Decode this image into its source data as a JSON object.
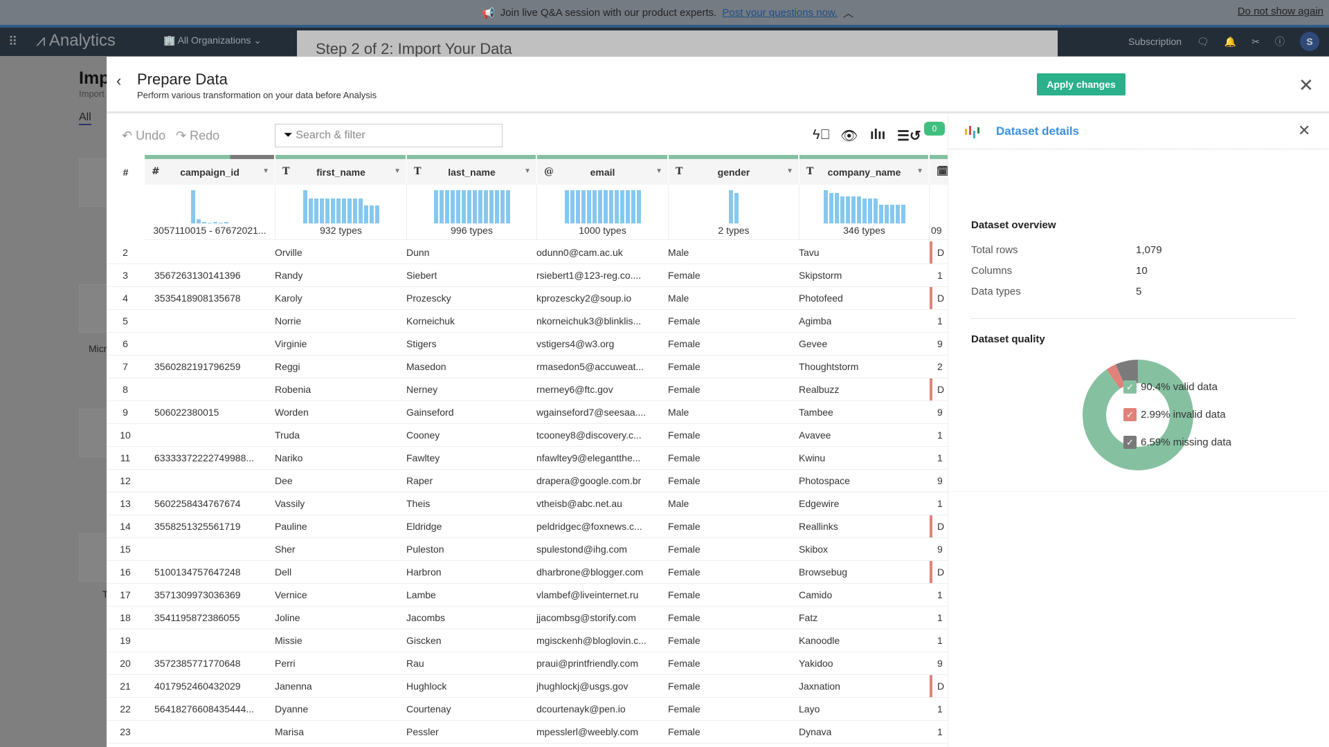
{
  "banner": {
    "message": "Join live Q&A session with our product experts.",
    "link": "Post your questions now.",
    "dismiss": "Do not show again"
  },
  "nav": {
    "app": "Analytics",
    "org": "All Organizations",
    "subscription": "Subscription",
    "avatar": "S"
  },
  "background": {
    "step": "Step 2 of 2: Import Your Data",
    "title": "Imp",
    "subtitle": "Import",
    "tab": "All",
    "card_text": "Micr",
    "card_text2": "T"
  },
  "modal": {
    "title": "Prepare Data",
    "subtitle": "Perform various transformation on your data before Analysis",
    "apply": "Apply changes"
  },
  "toolbar": {
    "undo": "Undo",
    "redo": "Redo",
    "search_placeholder": "Search & filter",
    "badge": "0"
  },
  "table": {
    "index_header": "#",
    "columns": [
      {
        "name": "campaign_id",
        "type": "#",
        "summary": "3057110015 - 67672021...",
        "hist": [
          100,
          12,
          4,
          3,
          4,
          3,
          4
        ],
        "quality": [
          0.66,
          0.34
        ]
      },
      {
        "name": "first_name",
        "type": "T",
        "summary": "932 types",
        "hist": [
          100,
          75,
          75,
          75,
          75,
          75,
          75,
          75,
          75,
          75,
          75,
          55,
          55,
          55
        ],
        "quality": [
          1,
          0
        ]
      },
      {
        "name": "last_name",
        "type": "T",
        "summary": "996 types",
        "hist": [
          100,
          100,
          100,
          100,
          100,
          100,
          100,
          100,
          100,
          100,
          100,
          100,
          100,
          100
        ],
        "quality": [
          1,
          0
        ]
      },
      {
        "name": "email",
        "type": "@",
        "summary": "1000 types",
        "hist": [
          100,
          100,
          100,
          100,
          100,
          100,
          100,
          100,
          100,
          100,
          100,
          100,
          100,
          100
        ],
        "quality": [
          1,
          0
        ]
      },
      {
        "name": "gender",
        "type": "T",
        "summary": "2 types",
        "hist": [
          100,
          92
        ],
        "quality": [
          1,
          0
        ]
      },
      {
        "name": "company_name",
        "type": "T",
        "summary": "346 types",
        "hist": [
          100,
          92,
          92,
          82,
          82,
          82,
          82,
          74,
          74,
          74,
          57,
          57,
          57,
          57,
          57
        ],
        "quality": [
          1,
          0
        ]
      },
      {
        "name": "",
        "type": "date",
        "summary": "09",
        "hist": [],
        "quality": [
          1,
          0
        ]
      }
    ],
    "rows": [
      [
        "2",
        "",
        "Orville",
        "Dunn",
        "odunn0@cam.ac.uk",
        "Male",
        "Tavu",
        "D",
        true
      ],
      [
        "3",
        "3567263130141396",
        "Randy",
        "Siebert",
        "rsiebert1@123-reg.co....",
        "Female",
        "Skipstorm",
        "1",
        false
      ],
      [
        "4",
        "3535418908135678",
        "Karoly",
        "Prozescky",
        "kprozescky2@soup.io",
        "Male",
        "Photofeed",
        "D",
        true
      ],
      [
        "5",
        "",
        "Norrie",
        "Korneichuk",
        "nkorneichuk3@blinklis...",
        "Female",
        "Agimba",
        "1",
        false
      ],
      [
        "6",
        "",
        "Virginie",
        "Stigers",
        "vstigers4@w3.org",
        "Female",
        "Gevee",
        "9",
        false
      ],
      [
        "7",
        "3560282191796259",
        "Reggi",
        "Masedon",
        "rmasedon5@accuweat...",
        "Female",
        "Thoughtstorm",
        "2",
        false
      ],
      [
        "8",
        "",
        "Robenia",
        "Nerney",
        "rnerney6@ftc.gov",
        "Female",
        "Realbuzz",
        "D",
        true
      ],
      [
        "9",
        "506022380015",
        "Worden",
        "Gainseford",
        "wgainseford7@seesaa....",
        "Male",
        "Tambee",
        "9",
        false
      ],
      [
        "10",
        "",
        "Truda",
        "Cooney",
        "tcooney8@discovery.c...",
        "Female",
        "Avavee",
        "1",
        false
      ],
      [
        "11",
        "63333372222749988...",
        "Nariko",
        "Fawltey",
        "nfawltey9@elegantthe...",
        "Female",
        "Kwinu",
        "1",
        false
      ],
      [
        "12",
        "",
        "Dee",
        "Raper",
        "drapera@google.com.br",
        "Female",
        "Photospace",
        "9",
        false
      ],
      [
        "13",
        "5602258434767674",
        "Vassily",
        "Theis",
        "vtheisb@abc.net.au",
        "Male",
        "Edgewire",
        "1",
        false
      ],
      [
        "14",
        "3558251325561719",
        "Pauline",
        "Eldridge",
        "peldridgec@foxnews.c...",
        "Female",
        "Reallinks",
        "D",
        true
      ],
      [
        "15",
        "",
        "Sher",
        "Puleston",
        "spulestond@ihg.com",
        "Female",
        "Skibox",
        "9",
        false
      ],
      [
        "16",
        "5100134757647248",
        "Dell",
        "Harbron",
        "dharbrone@blogger.com",
        "Female",
        "Browsebug",
        "D",
        true
      ],
      [
        "17",
        "3571309973036369",
        "Vernice",
        "Lambe",
        "vlambef@liveinternet.ru",
        "Female",
        "Camido",
        "1",
        false
      ],
      [
        "18",
        "3541195872386055",
        "Joline",
        "Jacombs",
        "jjacombsg@storify.com",
        "Female",
        "Fatz",
        "1",
        false
      ],
      [
        "19",
        "",
        "Missie",
        "Giscken",
        "mgisckenh@bloglovin.c...",
        "Female",
        "Kanoodle",
        "1",
        false
      ],
      [
        "20",
        "3572385771770648",
        "Perri",
        "Rau",
        "praui@printfriendly.com",
        "Female",
        "Yakidoo",
        "9",
        false
      ],
      [
        "21",
        "4017952460432029",
        "Janenna",
        "Hughlock",
        "jhughlockj@usgs.gov",
        "Female",
        "Jaxnation",
        "D",
        true
      ],
      [
        "22",
        "56418276608435444...",
        "Dyanne",
        "Courtenay",
        "dcourtenayk@pen.io",
        "Female",
        "Layo",
        "1",
        false
      ],
      [
        "23",
        "",
        "Marisa",
        "Pessler",
        "mpesslerl@weebly.com",
        "Female",
        "Dynava",
        "1",
        false
      ]
    ]
  },
  "details": {
    "title": "Dataset details",
    "overview_title": "Dataset overview",
    "overview": [
      {
        "label": "Total rows",
        "value": "1,079"
      },
      {
        "label": "Columns",
        "value": "10"
      },
      {
        "label": "Data types",
        "value": "5"
      }
    ],
    "quality_title": "Dataset quality",
    "quality": [
      {
        "label": "90.4% valid data",
        "pct": 90.4,
        "color": "#85c1a1"
      },
      {
        "label": "2.99% invalid data",
        "pct": 2.99,
        "color": "#e0827a"
      },
      {
        "label": "6.59% missing data",
        "pct": 6.59,
        "color": "#7a7a7a"
      }
    ]
  },
  "colors": {
    "accent": "#2bb08c",
    "link": "#3a8fe0",
    "hist": "#85c8ef",
    "valid": "#85c1a1",
    "invalid": "#e0827a",
    "missing": "#7a7a7a"
  }
}
